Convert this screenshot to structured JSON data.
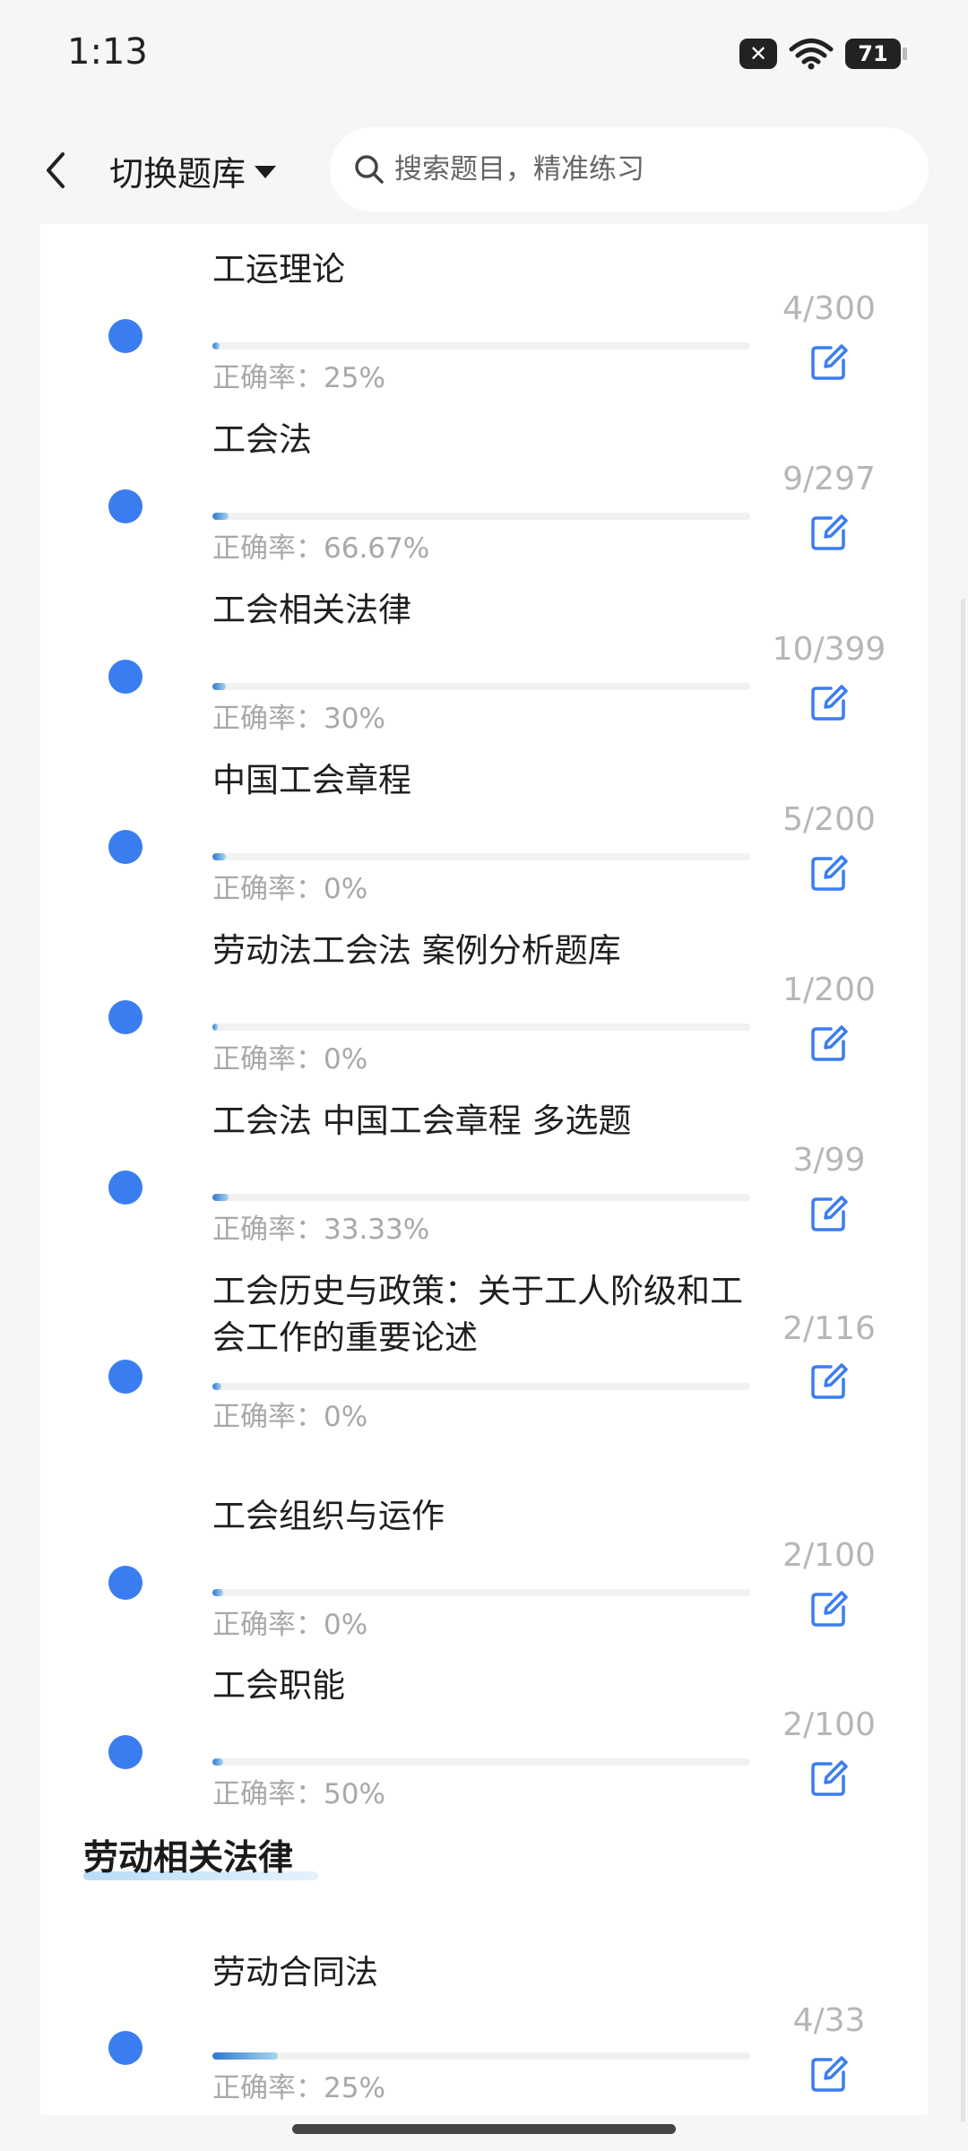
{
  "status_bar": {
    "time": "1:13",
    "battery": "71",
    "notification_icon": "close-x-badge-icon",
    "wifi_icon": "wifi-icon"
  },
  "header": {
    "back_icon": "chevron-left-icon",
    "bank_switch_label": "切换题库",
    "search_placeholder": "搜索题目，精准练习",
    "search_value": ""
  },
  "colors": {
    "accent": "#3a7df0",
    "progress_start": "#2e78d0",
    "progress_end": "#a9d6ee",
    "muted_text": "#a8a8a8"
  },
  "items": [
    {
      "title": "工运理论",
      "count": "4/300",
      "accuracy": "正确率：25%",
      "progress": 0.013
    },
    {
      "title": "工会法",
      "count": "9/297",
      "accuracy": "正确率：66.67%",
      "progress": 0.03
    },
    {
      "title": "工会相关法律",
      "count": "10/399",
      "accuracy": "正确率：30%",
      "progress": 0.025
    },
    {
      "title": "中国工会章程",
      "count": "5/200",
      "accuracy": "正确率：0%",
      "progress": 0.025
    },
    {
      "title": "劳动法工会法 案例分析题库",
      "count": "1/200",
      "accuracy": "正确率：0%",
      "progress": 0.005
    },
    {
      "title": "工会法 中国工会章程 多选题",
      "count": "3/99",
      "accuracy": "正确率：33.33%",
      "progress": 0.03
    },
    {
      "title": "工会历史与政策：关于工人阶级和工会工作的重要论述",
      "count": "2/116",
      "accuracy": "正确率：0%",
      "progress": 0.017
    },
    {
      "title": "工会组织与运作",
      "count": "2/100",
      "accuracy": "正确率：0%",
      "progress": 0.02
    },
    {
      "title": "工会职能",
      "count": "2/100",
      "accuracy": "正确率：50%",
      "progress": 0.02
    }
  ],
  "section": {
    "title": "劳动相关法律"
  },
  "section_items": [
    {
      "title": "劳动合同法",
      "count": "4/33",
      "accuracy": "正确率：25%",
      "progress": 0.121
    }
  ]
}
